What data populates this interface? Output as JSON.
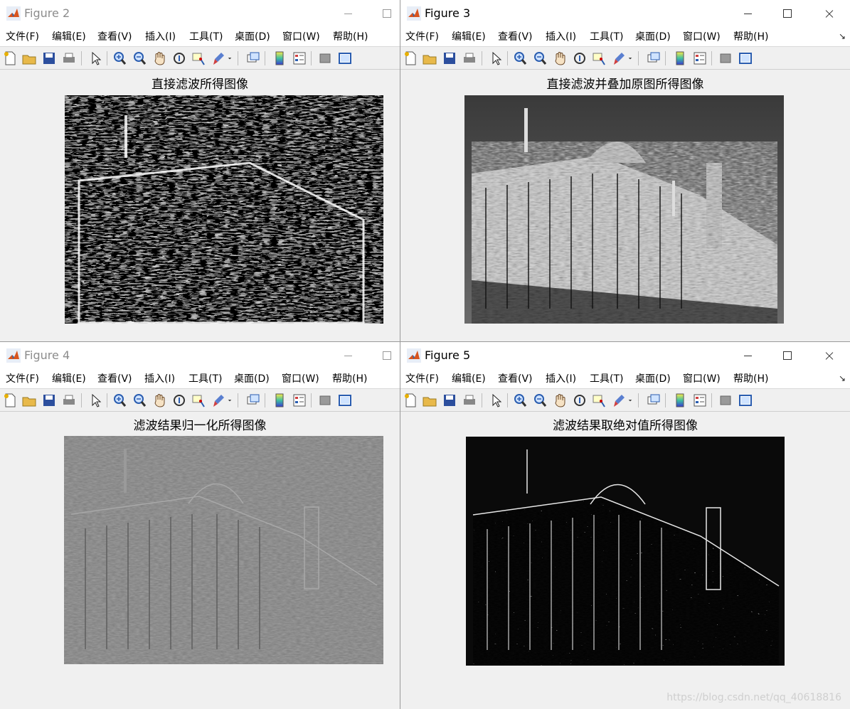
{
  "menu_labels": [
    "文件(F)",
    "编辑(E)",
    "查看(V)",
    "插入(I)",
    "工具(T)",
    "桌面(D)",
    "窗口(W)",
    "帮助(H)"
  ],
  "windows": {
    "fig2": {
      "title": "Figure 2",
      "plot_title": "直接滤波所得图像"
    },
    "fig3": {
      "title": "Figure 3",
      "plot_title": "直接滤波并叠加原图所得图像"
    },
    "fig4": {
      "title": "Figure 4",
      "plot_title": "滤波结果归一化所得图像"
    },
    "fig5": {
      "title": "Figure 5",
      "plot_title": "滤波结果取绝对值所得图像"
    }
  },
  "toolbar_icons": [
    "new-figure-icon",
    "open-folder-icon",
    "save-icon",
    "print-icon",
    "select-pointer-icon",
    "zoom-in-icon",
    "zoom-out-icon",
    "pan-hand-icon",
    "rotate-3d-icon",
    "data-cursor-icon",
    "brush-icon",
    "brush-dropdown-icon",
    "link-plot-icon",
    "colorbar-icon",
    "legend-icon",
    "hide-plot-tools-icon",
    "show-plot-tools-icon"
  ],
  "watermark": "https://blog.csdn.net/qq_40618816",
  "colors": {
    "titlebar": "#ffffff",
    "window_bg": "#f0f0f0",
    "separator": "#9a9a9a"
  }
}
